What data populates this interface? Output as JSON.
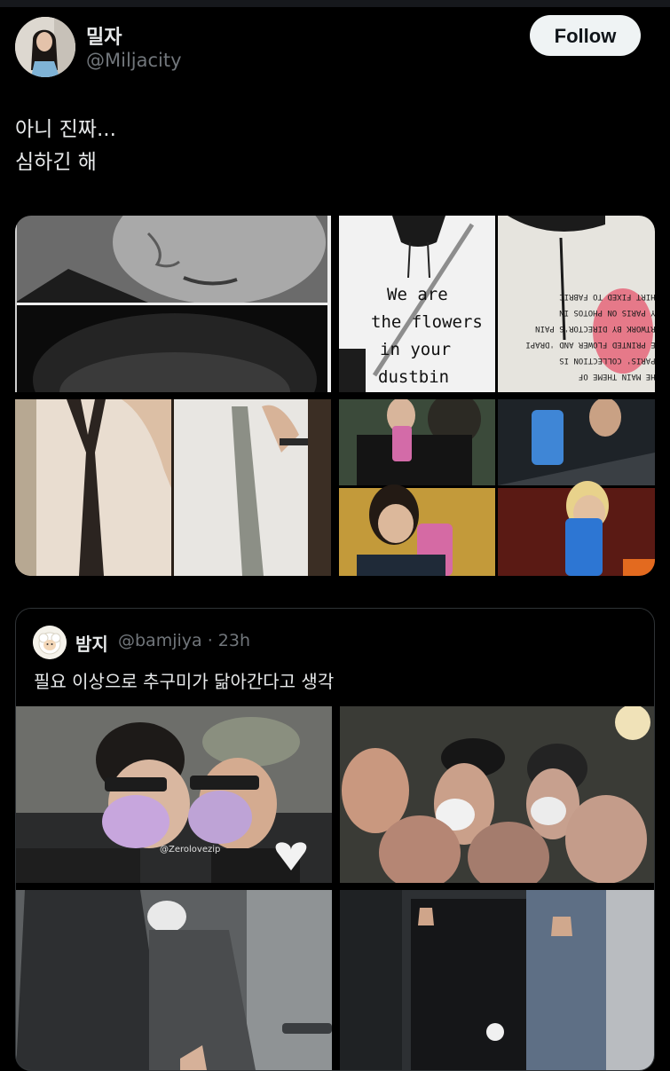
{
  "user": {
    "display_name": "밀자",
    "handle": "@Miljacity",
    "follow_label": "Follow"
  },
  "tweet": {
    "lines": [
      "아니 진짜...",
      "심하긴 해"
    ]
  },
  "shirt_prints": {
    "left": [
      "We are",
      "the flowers",
      "in your",
      "dustbin"
    ],
    "right": [
      "THE MAIN THEME OF",
      "'PARIS' COLLECTION IS",
      "WE PRINTED FLOWER AND 'DRAPI",
      "ARTWORK BY DIRECTOR'S PAIN",
      "BY PARIS ON PHOTOS IN",
      "SHIRT FIXED TO FABRIC"
    ]
  },
  "quoted": {
    "display_name": "밤지",
    "meta": "@bamjiya · 23h",
    "text": "필요 이상으로 추구미가 닮아간다고 생각",
    "watermark": "@Zerolovezip"
  },
  "colors": {
    "background": "#000000",
    "text_primary": "#e7e9ea",
    "text_secondary": "#71767b",
    "border": "#2f3336",
    "follow_bg": "#eff3f4",
    "follow_text": "#0f1419"
  }
}
